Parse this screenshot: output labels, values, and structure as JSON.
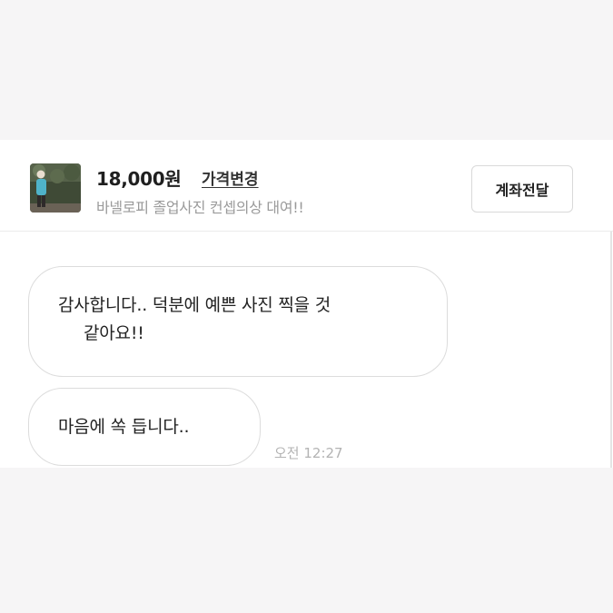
{
  "product": {
    "price": "18,000원",
    "price_change_label": "가격변경",
    "title": "바넬로피 졸업사진 컨셉의상 대여!!",
    "transfer_button_label": "계좌전달"
  },
  "messages": [
    {
      "lines": [
        "감사합니다.. 덕분에 예쁜 사진 찍을 것",
        "같아요!!"
      ]
    },
    {
      "text": "마음에 쏙 듭니다..",
      "time": "오전 12:27"
    }
  ],
  "colors": {
    "page_bg": "#f6f5f6",
    "card_bg": "#ffffff",
    "border": "#dcdcdc",
    "muted_text": "#9a9a9a",
    "timestamp_text": "#b3b3b3"
  }
}
